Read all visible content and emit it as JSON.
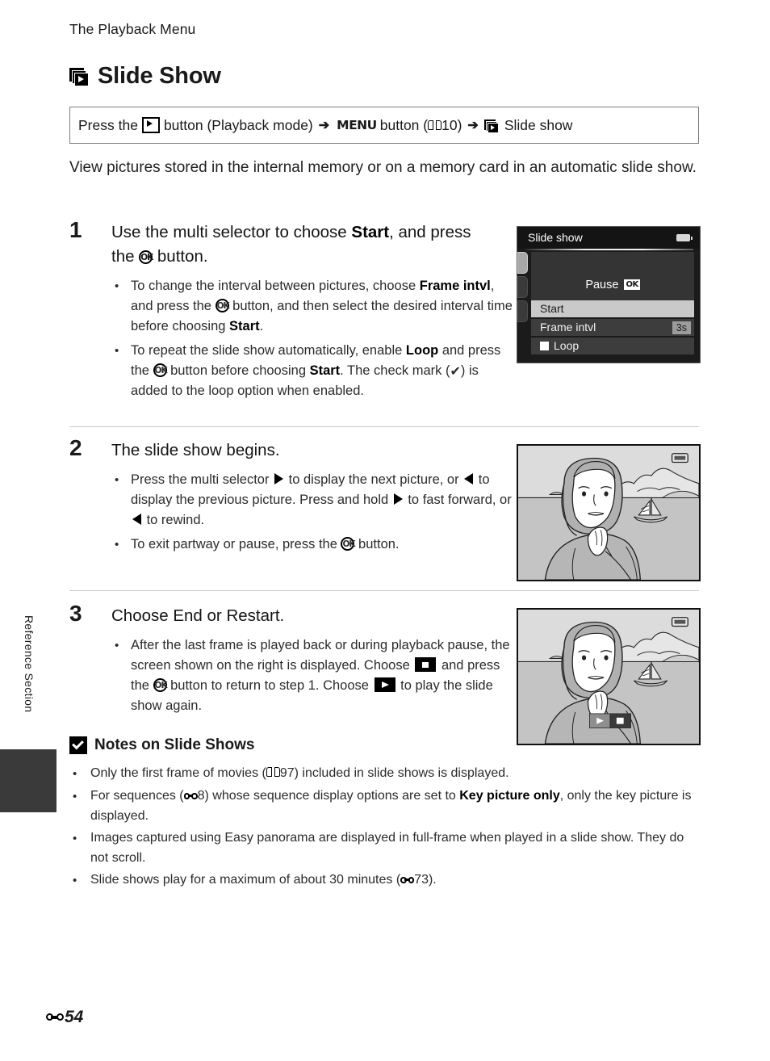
{
  "running_head": "The Playback Menu",
  "chapter": {
    "icon": "slideshow-icon",
    "title": "Slide Show"
  },
  "path_box": {
    "press_the": "Press the",
    "playback_icon": "playback-button-icon",
    "button_playback_mode": "button (Playback mode)",
    "arrow1": "➔",
    "menu_label": "MENU",
    "menu_button": "button (",
    "book_icon": "manual-reference-icon",
    "page_ref": "10)",
    "close_paren": ")",
    "arrow2": "➔",
    "slideshow_icon": "slideshow-icon",
    "slide_show_label": "Slide show"
  },
  "intro": "View pictures stored in the internal memory or on a memory card in an automatic slide show.",
  "steps": [
    {
      "number": "1",
      "heading_a": "Use the multi selector to choose ",
      "heading_bold": "Start",
      "heading_b": ", and press the ",
      "heading_c": " button.",
      "bullets": [
        {
          "t1": "To change the interval between pictures, choose ",
          "b1": "Frame intvl",
          "t2": ", and press the ",
          "t3": " button, and then select the desired interval time before choosing ",
          "b2": "Start",
          "t4": "."
        },
        {
          "t1": "To repeat the slide show automatically, enable ",
          "b1": "Loop",
          "t2": " and press the ",
          "t3": " button before choosing ",
          "b2": "Start",
          "t4": ". The check mark (",
          "t5": ") is added to the loop option when enabled."
        }
      ]
    },
    {
      "number": "2",
      "heading_a": "The slide show begins.",
      "bullets": [
        {
          "t1": "Press the multi selector ",
          "t2": " to display the next picture, or ",
          "t3": " to display the previous picture. Press and hold ",
          "t4": " to fast forward, or ",
          "t5": " to rewind."
        },
        {
          "t1": "To exit partway or pause, press the ",
          "t2": " button."
        }
      ]
    },
    {
      "number": "3",
      "heading_a": "Choose End or Restart.",
      "bullets": [
        {
          "t1": "After the last frame is played back or during playback pause, the screen shown on the right is displayed. Choose ",
          "t2": " and press the ",
          "t3": " button to return to step 1. Choose ",
          "t4": " to play the slide show again."
        }
      ]
    }
  ],
  "lcd": {
    "title": "Slide show",
    "battery_icon": "battery-icon",
    "canvas_text": "Pause",
    "canvas_ok_badge": "OK",
    "items": [
      {
        "label": "Start",
        "value": "",
        "selected": true,
        "checkbox": false
      },
      {
        "label": "Frame intvl",
        "value": "3s",
        "selected": false,
        "checkbox": false
      },
      {
        "label": "Loop",
        "value": "",
        "selected": false,
        "checkbox": true
      }
    ],
    "tabs": [
      "tab-playback",
      "tab-setup",
      "tab-network"
    ]
  },
  "illustrations": {
    "step2_alt": "woman-by-the-sea-with-sailboat",
    "step3_alt": "woman-by-the-sea-with-sailboat-and-playback-controls",
    "controls": {
      "play": "play-icon",
      "stop": "stop-icon"
    }
  },
  "notes": {
    "icon": "caution-check-icon",
    "heading": "Notes on Slide Shows",
    "items": [
      {
        "t1": "Only the first frame of movies (",
        "ref_icon": "manual-reference-icon",
        "t2": "97) included in slide shows is displayed."
      },
      {
        "t1": "For sequences (",
        "ref_icon": "reference-section-icon",
        "t2": "8) whose sequence display options are set to ",
        "b1": "Key picture only",
        "t3": ", only the key picture is displayed."
      },
      {
        "t1": "Images captured using Easy panorama are displayed in full-frame when played in a slide show. They do not scroll."
      },
      {
        "t1": "Slide shows play for a maximum of about 30 minutes (",
        "ref_icon": "reference-section-icon",
        "t2": "73)."
      }
    ]
  },
  "sidebar": {
    "label": "Reference Section"
  },
  "footer": {
    "icon": "reference-section-icon",
    "page": "54"
  },
  "colors": {
    "text": "#1a1a1a",
    "body_text": "#2b2b2b",
    "divider": "#c9c9c9",
    "path_border": "#7d7d7d",
    "lcd_bg": "#1b1b1b",
    "lcd_selected": "#c9c9c9",
    "sidebar_tab": "#3a3a3a"
  }
}
